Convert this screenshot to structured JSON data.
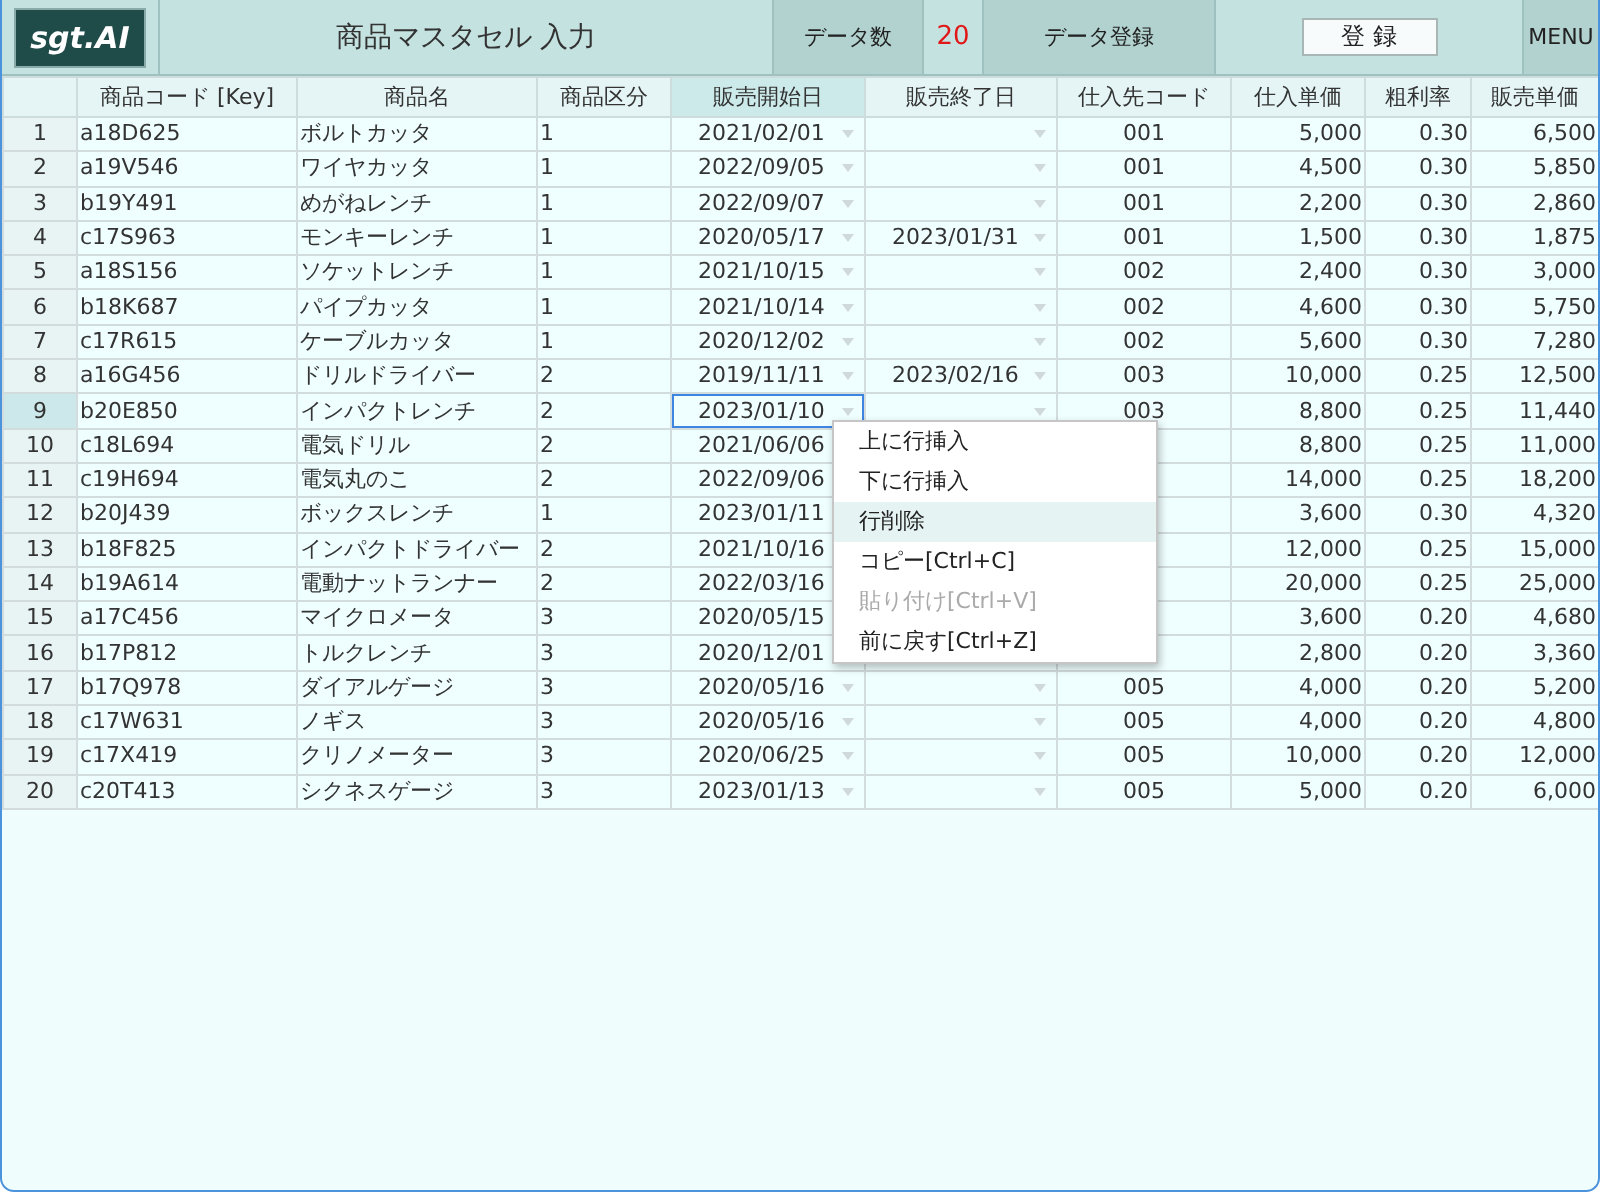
{
  "header": {
    "logo": "sgt.AI",
    "title": "商品マスタセル 入力",
    "count_label": "データ数",
    "count": "20",
    "register_label": "データ登録",
    "register_button": "登 録",
    "menu_button": "MENU"
  },
  "table": {
    "columns": [
      {
        "label": "商品コード [Key]",
        "kind": "text",
        "selected": false
      },
      {
        "label": "商品名",
        "kind": "text",
        "selected": false
      },
      {
        "label": "商品区分",
        "kind": "text",
        "selected": false
      },
      {
        "label": "販売開始日",
        "kind": "date",
        "selected": true
      },
      {
        "label": "販売終了日",
        "kind": "date",
        "selected": false
      },
      {
        "label": "仕入先コード",
        "kind": "code",
        "selected": false
      },
      {
        "label": "仕入単価",
        "kind": "number",
        "selected": false
      },
      {
        "label": "粗利率",
        "kind": "number",
        "selected": false
      },
      {
        "label": "販売単価",
        "kind": "number",
        "selected": false
      }
    ],
    "rows": [
      {
        "number": "1",
        "selected": false,
        "cells": [
          "a18D625",
          "ボルトカッタ",
          "1",
          "2021/02/01",
          null,
          "001",
          "5,000",
          "0.30",
          "6,500"
        ]
      },
      {
        "number": "2",
        "selected": false,
        "cells": [
          "a19V546",
          "ワイヤカッタ",
          "1",
          "2022/09/05",
          null,
          "001",
          "4,500",
          "0.30",
          "5,850"
        ]
      },
      {
        "number": "3",
        "selected": false,
        "cells": [
          "b19Y491",
          "めがねレンチ",
          "1",
          "2022/09/07",
          null,
          "001",
          "2,200",
          "0.30",
          "2,860"
        ]
      },
      {
        "number": "4",
        "selected": false,
        "cells": [
          "c17S963",
          "モンキーレンチ",
          "1",
          "2020/05/17",
          "2023/01/31",
          "001",
          "1,500",
          "0.30",
          "1,875"
        ]
      },
      {
        "number": "5",
        "selected": false,
        "cells": [
          "a18S156",
          "ソケットレンチ",
          "1",
          "2021/10/15",
          null,
          "002",
          "2,400",
          "0.30",
          "3,000"
        ]
      },
      {
        "number": "6",
        "selected": false,
        "cells": [
          "b18K687",
          "パイプカッタ",
          "1",
          "2021/10/14",
          null,
          "002",
          "4,600",
          "0.30",
          "5,750"
        ]
      },
      {
        "number": "7",
        "selected": false,
        "cells": [
          "c17R615",
          "ケーブルカッタ",
          "1",
          "2020/12/02",
          null,
          "002",
          "5,600",
          "0.30",
          "7,280"
        ]
      },
      {
        "number": "8",
        "selected": false,
        "cells": [
          "a16G456",
          "ドリルドライバー",
          "2",
          "2019/11/11",
          "2023/02/16",
          "003",
          "10,000",
          "0.25",
          "12,500"
        ]
      },
      {
        "number": "9",
        "selected": true,
        "cells": [
          "b20E850",
          "インパクトレンチ",
          "2",
          "2023/01/10",
          null,
          "003",
          "8,800",
          "0.25",
          "11,440"
        ]
      },
      {
        "number": "10",
        "selected": false,
        "cells": [
          "c18L694",
          "電気ドリル",
          "2",
          "2021/06/06",
          null,
          null,
          "8,800",
          "0.25",
          "11,000"
        ]
      },
      {
        "number": "11",
        "selected": false,
        "cells": [
          "c19H694",
          "電気丸のこ",
          "2",
          "2022/09/06",
          null,
          null,
          "14,000",
          "0.25",
          "18,200"
        ]
      },
      {
        "number": "12",
        "selected": false,
        "cells": [
          "b20J439",
          "ボックスレンチ",
          "1",
          "2023/01/11",
          null,
          null,
          "3,600",
          "0.30",
          "4,320"
        ]
      },
      {
        "number": "13",
        "selected": false,
        "cells": [
          "b18F825",
          "インパクトドライバー",
          "2",
          "2021/10/16",
          null,
          null,
          "12,000",
          "0.25",
          "15,000"
        ]
      },
      {
        "number": "14",
        "selected": false,
        "cells": [
          "b19A614",
          "電動ナットランナー",
          "2",
          "2022/03/16",
          null,
          null,
          "20,000",
          "0.25",
          "25,000"
        ]
      },
      {
        "number": "15",
        "selected": false,
        "cells": [
          "a17C456",
          "マイクロメータ",
          "3",
          "2020/05/15",
          null,
          null,
          "3,600",
          "0.20",
          "4,680"
        ]
      },
      {
        "number": "16",
        "selected": false,
        "cells": [
          "b17P812",
          "トルクレンチ",
          "3",
          "2020/12/01",
          null,
          null,
          "2,800",
          "0.20",
          "3,360"
        ]
      },
      {
        "number": "17",
        "selected": false,
        "cells": [
          "b17Q978",
          "ダイアルゲージ",
          "3",
          "2020/05/16",
          null,
          "005",
          "4,000",
          "0.20",
          "5,200"
        ]
      },
      {
        "number": "18",
        "selected": false,
        "cells": [
          "c17W631",
          "ノギス",
          "3",
          "2020/05/16",
          null,
          "005",
          "4,000",
          "0.20",
          "4,800"
        ]
      },
      {
        "number": "19",
        "selected": false,
        "cells": [
          "c17X419",
          "クリノメーター",
          "3",
          "2020/06/25",
          null,
          "005",
          "10,000",
          "0.20",
          "12,000"
        ]
      },
      {
        "number": "20",
        "selected": false,
        "cells": [
          "c20T413",
          "シクネスゲージ",
          "3",
          "2023/01/13",
          null,
          "005",
          "5,000",
          "0.20",
          "6,000"
        ]
      }
    ]
  },
  "context_menu": {
    "items": [
      {
        "label": "上に行挿入",
        "highlighted": false,
        "disabled": false
      },
      {
        "label": "下に行挿入",
        "highlighted": false,
        "disabled": false
      },
      {
        "label": "行削除",
        "highlighted": true,
        "disabled": false
      },
      {
        "label": "コピー[Ctrl+C]",
        "highlighted": false,
        "disabled": false
      },
      {
        "label": "貼り付け[Ctrl+V]",
        "highlighted": false,
        "disabled": true
      },
      {
        "label": "前に戻す[Ctrl+Z]",
        "highlighted": false,
        "disabled": false
      }
    ]
  }
}
